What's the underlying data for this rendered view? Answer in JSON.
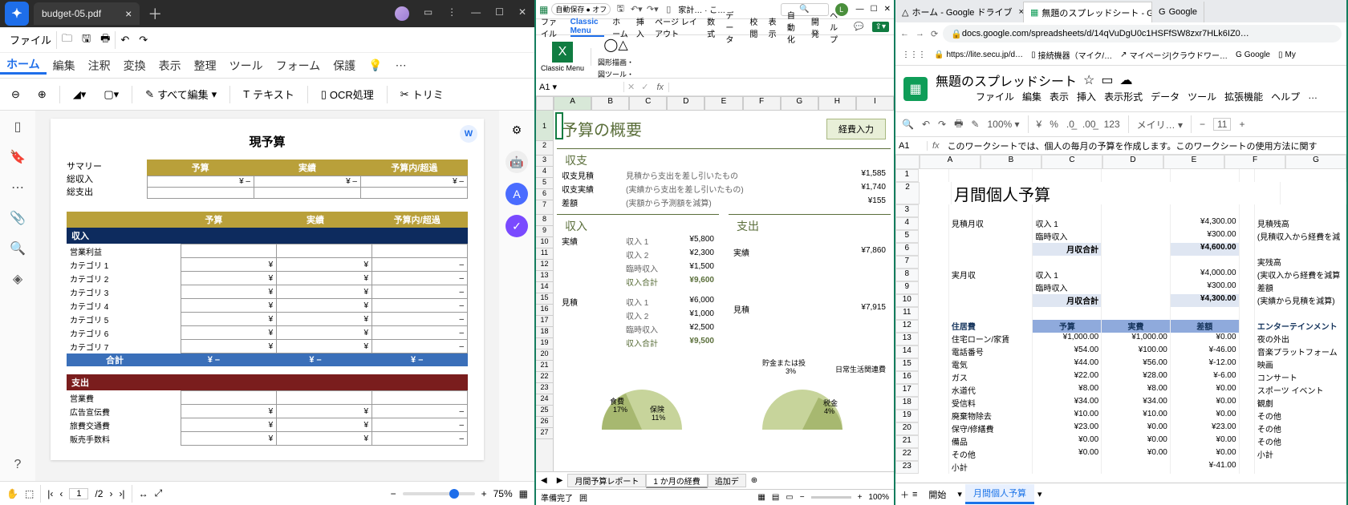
{
  "p1": {
    "tab_title": "budget-05.pdf",
    "menubar": {
      "file": "ファイル"
    },
    "ribbon": [
      "ホーム",
      "編集",
      "注釈",
      "変換",
      "表示",
      "整理",
      "ツール",
      "フォーム",
      "保護"
    ],
    "toolbar": {
      "edit_all": "すべて編集",
      "text": "テキスト",
      "ocr": "OCR処理",
      "trim": "トリミ"
    },
    "doc": {
      "title": "現予算",
      "summary_label": "サマリー",
      "sum_in": "総収入",
      "sum_out": "総支出",
      "col_budget": "予算",
      "col_actual": "実績",
      "col_diff": "予算内/超過",
      "income_label": "収入",
      "profit_label": "営業利益",
      "cats": [
        "カテゴリ 1",
        "カテゴリ 2",
        "カテゴリ 3",
        "カテゴリ 4",
        "カテゴリ 5",
        "カテゴリ 6",
        "カテゴリ 7"
      ],
      "total_label": "合計",
      "expense_label": "支出",
      "opex_label": "営業費",
      "exp_rows": [
        "広告宣伝費",
        "旅費交通費",
        "販売手数料"
      ]
    },
    "status": {
      "page_cur": "1",
      "page_total": "/2",
      "zoom": "75%"
    }
  },
  "p2": {
    "autosave": "自動保存",
    "autosave_state": "● オフ",
    "filename": "家計… · こ…",
    "menus": [
      "ファイル",
      "Classic Menu",
      "ホーム",
      "挿入",
      "ページ レイアウト",
      "数式",
      "データ",
      "校閲",
      "表示",
      "自動化",
      "開発",
      "ヘルプ"
    ],
    "ribbon": {
      "classic": "Classic Menu",
      "fig_desc": "図形描画・",
      "fig_tool": "図ツール・"
    },
    "namebox": "A1",
    "title": "予算の概要",
    "btn_keihi": "経費入力",
    "sec_balance": "収支",
    "balance": [
      {
        "k": "収支見積",
        "d": "見積から支出を差し引いたもの",
        "v": "¥1,585"
      },
      {
        "k": "収支実績",
        "d": "(実績から支出を差し引いたもの)",
        "v": "¥1,740"
      },
      {
        "k": "差額",
        "d": "(実額から予測額を減算)",
        "v": "¥155"
      }
    ],
    "sec_income": "収入",
    "sec_expense": "支出",
    "lbl_actual": "実績",
    "lbl_estimate": "見積",
    "income_actual": [
      {
        "k": "収入 1",
        "v": "¥5,800"
      },
      {
        "k": "収入 2",
        "v": "¥2,300"
      },
      {
        "k": "臨時収入",
        "v": "¥1,500"
      },
      {
        "k": "収入合計",
        "v": "¥9,600",
        "sum": true
      }
    ],
    "income_est": [
      {
        "k": "収入 1",
        "v": "¥6,000"
      },
      {
        "k": "収入 2",
        "v": "¥1,000"
      },
      {
        "k": "臨時収入",
        "v": "¥2,500"
      },
      {
        "k": "収入合計",
        "v": "¥9,500",
        "sum": true
      }
    ],
    "exp_actual": "¥7,860",
    "exp_est": "¥7,915",
    "chart_labels": {
      "savings": "貯金または投",
      "savings_pct": "3%",
      "daily": "日常生活関連費",
      "food": "食費",
      "food_pct": "17%",
      "ins": "保険",
      "ins_pct": "11%",
      "tax": "税金",
      "tax_pct": "4%"
    },
    "tabs": [
      "月間予算レポート",
      "1 か月の経費",
      "追加デ"
    ],
    "status": {
      "ready": "準備完了",
      "acc": "囲"
    }
  },
  "p3": {
    "tabs": [
      {
        "icon": "△",
        "label": "ホーム - Google ドライブ"
      },
      {
        "icon": "▦",
        "label": "無題のスプレッドシート - Google ス",
        "active": true
      },
      {
        "icon": "G",
        "label": "Google"
      }
    ],
    "url": "docs.google.com/spreadsheets/d/14qVuDgU0c1HSFfSW8zxr7HLk6IZ0…",
    "bookmarks": [
      "https://lite.secu.jp/d…",
      "接続機器（マイク/…",
      "マイページ|クラウドワー…",
      "Google",
      "My"
    ],
    "doc_title": "無題のスプレッドシート",
    "menus": [
      "ファイル",
      "編集",
      "表示",
      "挿入",
      "表示形式",
      "データ",
      "ツール",
      "拡張機能",
      "ヘルプ",
      "…"
    ],
    "toolbar": {
      "zoom": "100%",
      "font": "メイリ…",
      "size": "11"
    },
    "namebox": "A1",
    "fx": "このワークシートでは、個人の毎月の予算を作成します。このワークシートの使用方法に関す",
    "cols": [
      "A",
      "B",
      "C",
      "D",
      "E",
      "F",
      "G"
    ],
    "title": "月間個人予算",
    "blk1_label": "見積月収",
    "blk1": [
      [
        "収入 1",
        "¥4,300.00"
      ],
      [
        "臨時収入",
        "¥300.00"
      ],
      [
        "月収合計",
        "¥4,600.00"
      ]
    ],
    "blk1_side": [
      "見積残高",
      "(見積収入から経費を減"
    ],
    "blk2_label": "実月収",
    "blk2": [
      [
        "収入 1",
        "¥4,000.00"
      ],
      [
        "臨時収入",
        "¥300.00"
      ],
      [
        "月収合計",
        "¥4,300.00"
      ]
    ],
    "blk2_side": [
      "実残高",
      "(実収入から経費を減算",
      "差額",
      "(実績から見積を減算)"
    ],
    "grid_hdr": [
      "住居費",
      "予算",
      "実費",
      "差額",
      "エンターテインメント"
    ],
    "grid": [
      [
        "住宅ローン/家賃",
        "¥1,000.00",
        "¥1,000.00",
        "¥0.00",
        "夜の外出"
      ],
      [
        "電話番号",
        "¥54.00",
        "¥100.00",
        "¥-46.00",
        "音楽プラットフォーム"
      ],
      [
        "電気",
        "¥44.00",
        "¥56.00",
        "¥-12.00",
        "映画"
      ],
      [
        "ガス",
        "¥22.00",
        "¥28.00",
        "¥-6.00",
        "コンサート"
      ],
      [
        "水道代",
        "¥8.00",
        "¥8.00",
        "¥0.00",
        "スポーツ イベント"
      ],
      [
        "受信料",
        "¥34.00",
        "¥34.00",
        "¥0.00",
        "観劇"
      ],
      [
        "廃棄物除去",
        "¥10.00",
        "¥10.00",
        "¥0.00",
        "その他"
      ],
      [
        "保守/修繕費",
        "¥23.00",
        "¥0.00",
        "¥23.00",
        "その他"
      ],
      [
        "備品",
        "¥0.00",
        "¥0.00",
        "¥0.00",
        "その他"
      ],
      [
        "その他",
        "¥0.00",
        "¥0.00",
        "¥0.00",
        "小計"
      ],
      [
        "小計",
        "",
        "",
        "¥-41.00",
        ""
      ]
    ],
    "sheet_tabs": [
      "開始",
      "月間個人予算"
    ]
  }
}
